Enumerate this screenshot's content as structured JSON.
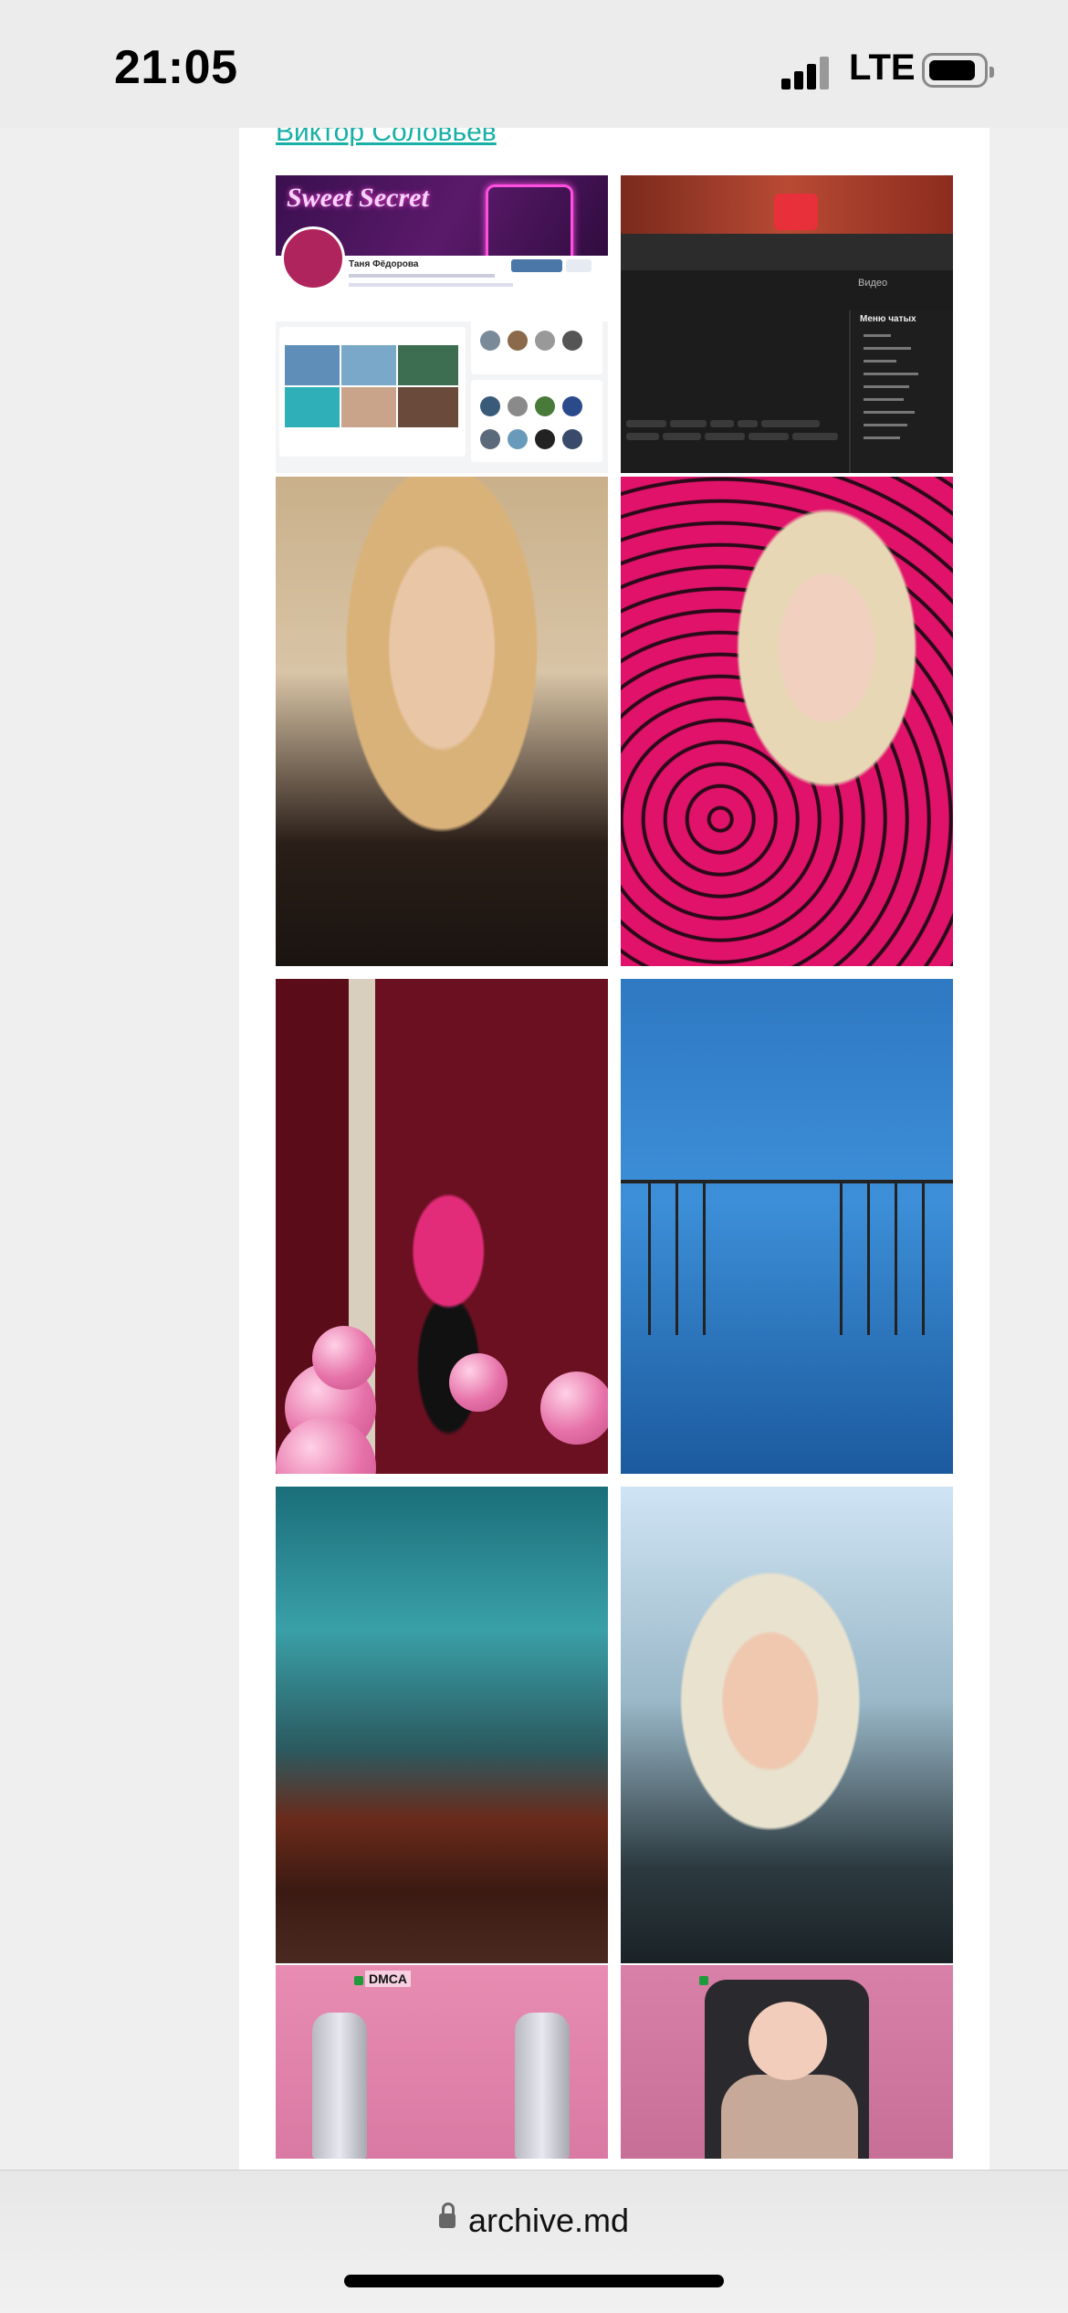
{
  "status_bar": {
    "time": "21:05",
    "network": "LTE"
  },
  "article": {
    "author_link": "Виктор Соловьев",
    "vk_screenshot": {
      "cover_text": "Sweet Secret",
      "profile_name": "Таня Фёдорова"
    },
    "dark_screenshot": {
      "panel_title": "Видео",
      "menu_title": "Меню чатых"
    },
    "stream_overlay": "DMCA"
  },
  "browser": {
    "url": "archive.md"
  }
}
